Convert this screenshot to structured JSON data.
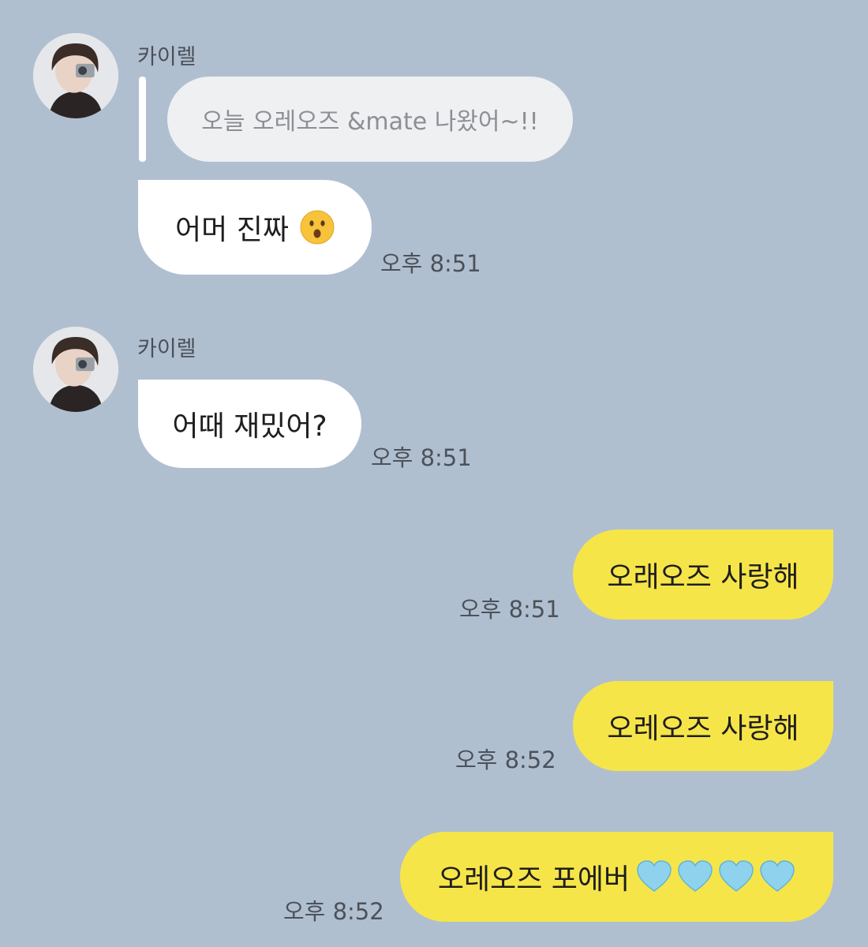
{
  "conversation": {
    "contact_name": "카이렐",
    "messages": [
      {
        "group": 1,
        "sender": "카이렐",
        "quote_text": "오늘 오레오즈 &mate 나왔어~!!",
        "text": "어머 진짜",
        "emoji": "hushed-face-icon",
        "time": "오후 8:51"
      },
      {
        "group": 2,
        "sender": "카이렐",
        "text": "어때 재밌어?",
        "time": "오후 8:51"
      },
      {
        "direction": "out",
        "text": "오래오즈 사랑해",
        "time": "오후 8:51"
      },
      {
        "direction": "out",
        "text": "오레오즈 사랑해",
        "time": "오후 8:52"
      },
      {
        "direction": "out",
        "text": "오레오즈 포에버",
        "hearts": [
          "light-blue-heart-icon",
          "light-blue-heart-icon",
          "light-blue-heart-icon",
          "light-blue-heart-icon"
        ],
        "time": "오후 8:52"
      }
    ]
  },
  "colors": {
    "background": "#b0bfd0",
    "incoming_bubble": "#ffffff",
    "outgoing_bubble": "#f6e549",
    "quote_bubble": "#eff0f2",
    "heart": "#8fd2ee"
  }
}
